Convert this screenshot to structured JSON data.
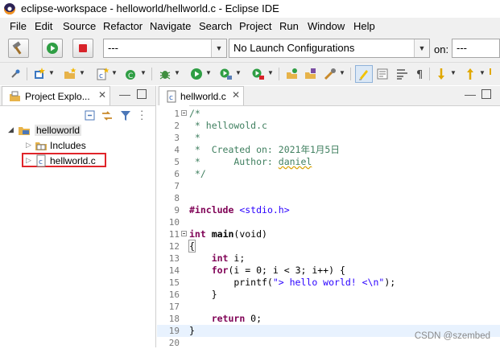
{
  "window": {
    "title": "eclipse-workspace - helloworld/hellworld.c - Eclipse IDE"
  },
  "menu": [
    "File",
    "Edit",
    "Source",
    "Refactor",
    "Navigate",
    "Search",
    "Project",
    "Run",
    "Window",
    "Help"
  ],
  "launch": {
    "mode_value": "---",
    "config_value": "No Launch Configurations",
    "on_label": "on:",
    "target_value": "---"
  },
  "project_explorer": {
    "tab_label": "Project Explo...",
    "tree": [
      {
        "label": "helloworld",
        "icon": "project-folder-icon",
        "expanded": true
      },
      {
        "label": "Includes",
        "icon": "includes-icon",
        "expanded": false
      },
      {
        "label": "hellworld.c",
        "icon": "c-file-icon",
        "expanded": false,
        "highlighted": true
      }
    ]
  },
  "editor": {
    "tab_label": "hellworld.c",
    "lines": [
      {
        "n": "1",
        "fold": "minus",
        "text": "/*"
      },
      {
        "n": "2",
        "text": " * hellowold.c"
      },
      {
        "n": "3",
        "text": " *"
      },
      {
        "n": "4",
        "text": " *  Created on: 2021年1月5日"
      },
      {
        "n": "5",
        "text": " *      Author: daniel"
      },
      {
        "n": "6",
        "text": " */"
      },
      {
        "n": "7",
        "text": ""
      },
      {
        "n": "8",
        "text": ""
      },
      {
        "n": "9",
        "text": "#include <stdio.h>"
      },
      {
        "n": "10",
        "text": ""
      },
      {
        "n": "11",
        "fold": "minus",
        "text": "int main(void)"
      },
      {
        "n": "12",
        "text": "{"
      },
      {
        "n": "13",
        "text": "    int i;"
      },
      {
        "n": "14",
        "text": "    for(i = 0; i < 3; i++) {"
      },
      {
        "n": "15",
        "text": "        printf(\"> hello world! <\\n\");"
      },
      {
        "n": "16",
        "text": "    }"
      },
      {
        "n": "17",
        "text": ""
      },
      {
        "n": "18",
        "text": "    return 0;"
      },
      {
        "n": "19",
        "text": "}"
      },
      {
        "n": "20",
        "text": ""
      }
    ]
  },
  "watermark": "CSDN @szembed",
  "colors": {
    "highlight_box": "#e0242a",
    "comment": "#3f7f5f",
    "keyword": "#7f0055",
    "string": "#2a00ff"
  }
}
